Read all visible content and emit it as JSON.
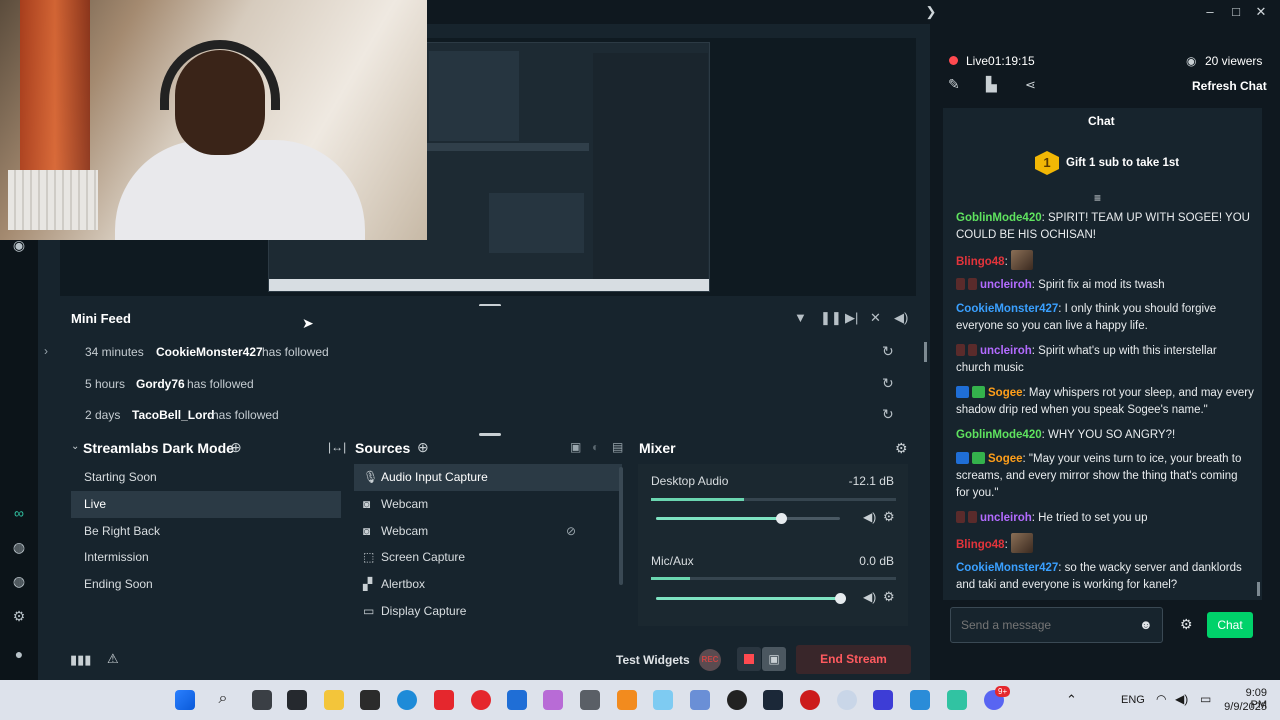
{
  "window": {
    "collapse_glyph": "❯",
    "minimize": "–",
    "maximize": "□",
    "close": "✕"
  },
  "colors": {
    "background": "#17242d",
    "accent_green": "#31c3a2",
    "chat_button": "#00d26a",
    "end_stream": "#ff5a5f"
  },
  "mini_feed": {
    "title": "Mini Feed",
    "items": [
      {
        "time": "34 minutes",
        "name": "CookieMonster427",
        "action": "has followed"
      },
      {
        "time": "5 hours",
        "name": "Gordy76",
        "action": "has followed"
      },
      {
        "time": "2 days",
        "name": "TacoBell_Lord",
        "action": "has followed"
      }
    ]
  },
  "scenes": {
    "title": "Streamlabs Dark Mode",
    "items": [
      "Starting Soon",
      "Live",
      "Be Right Back",
      "Intermission",
      "Ending Soon"
    ],
    "active_index": 1
  },
  "sources": {
    "title": "Sources",
    "items": [
      {
        "label": "Audio Input Capture",
        "icon": "microphone-icon"
      },
      {
        "label": "Webcam",
        "icon": "webcam-icon"
      },
      {
        "label": "Webcam",
        "icon": "webcam-icon"
      },
      {
        "label": "Screen Capture",
        "icon": "screen-capture-icon"
      },
      {
        "label": "Alertbox",
        "icon": "alertbox-icon"
      },
      {
        "label": "Display Capture",
        "icon": "monitor-icon"
      }
    ]
  },
  "mixer": {
    "title": "Mixer",
    "channels": [
      {
        "name": "Desktop Audio",
        "db": "-12.1 dB",
        "level": 0.38,
        "volume": 0.68
      },
      {
        "name": "Mic/Aux",
        "db": "0.0 dB",
        "level": 0.16,
        "volume": 1.0
      }
    ]
  },
  "footer": {
    "test_widgets": "Test Widgets",
    "rec": "REC",
    "end_stream": "End Stream"
  },
  "stream": {
    "status": "Live",
    "uptime": "01:19:15",
    "viewers": "20 viewers",
    "refresh": "Refresh Chat"
  },
  "chat": {
    "title": "Chat",
    "gift_rank": "1",
    "gift_text": "Gift 1 sub to take 1st",
    "messages": [
      {
        "user": "GoblinMode420",
        "color": "green",
        "text": ": SPIRIT! TEAM UP WITH SOGEE! YOU COULD BE HIS OCHISAN!"
      },
      {
        "user": "Blingo48",
        "color": "red",
        "text": ":"
      },
      {
        "user": "uncleiroh",
        "color": "purple",
        "text": ": Spirit fix ai mod its twash"
      },
      {
        "user": "CookieMonster427",
        "color": "blue",
        "text": ": I only think you should forgive everyone so you can live a happy life."
      },
      {
        "user": "uncleiroh",
        "color": "purple",
        "text": ": Spirit what's up with this interstellar church music"
      },
      {
        "user": "Sogee",
        "color": "orange",
        "text": ": May whispers rot your sleep, and may every shadow drip red when you speak Sogee's name.\""
      },
      {
        "user": "GoblinMode420",
        "color": "green",
        "text": ": WHY YOU SO ANGRY?!"
      },
      {
        "user": "Sogee",
        "color": "orange",
        "text": ": \"May your veins turn to ice, your breath to screams, and every mirror show the thing that's coming for you.\""
      },
      {
        "user": "uncleiroh",
        "color": "purple",
        "text": ": He tried to set you up"
      },
      {
        "user": "Blingo48",
        "color": "red",
        "text": ":"
      },
      {
        "user": "CookieMonster427",
        "color": "blue",
        "text": ": so the wacky server and danklords and taki and everyone is working for kanel?"
      }
    ],
    "input_placeholder": "Send a message",
    "send_label": "Chat"
  },
  "taskbar": {
    "language": "ENG",
    "time": "9:09 PM",
    "date": "9/9/2025",
    "discord_badge": "9+"
  }
}
